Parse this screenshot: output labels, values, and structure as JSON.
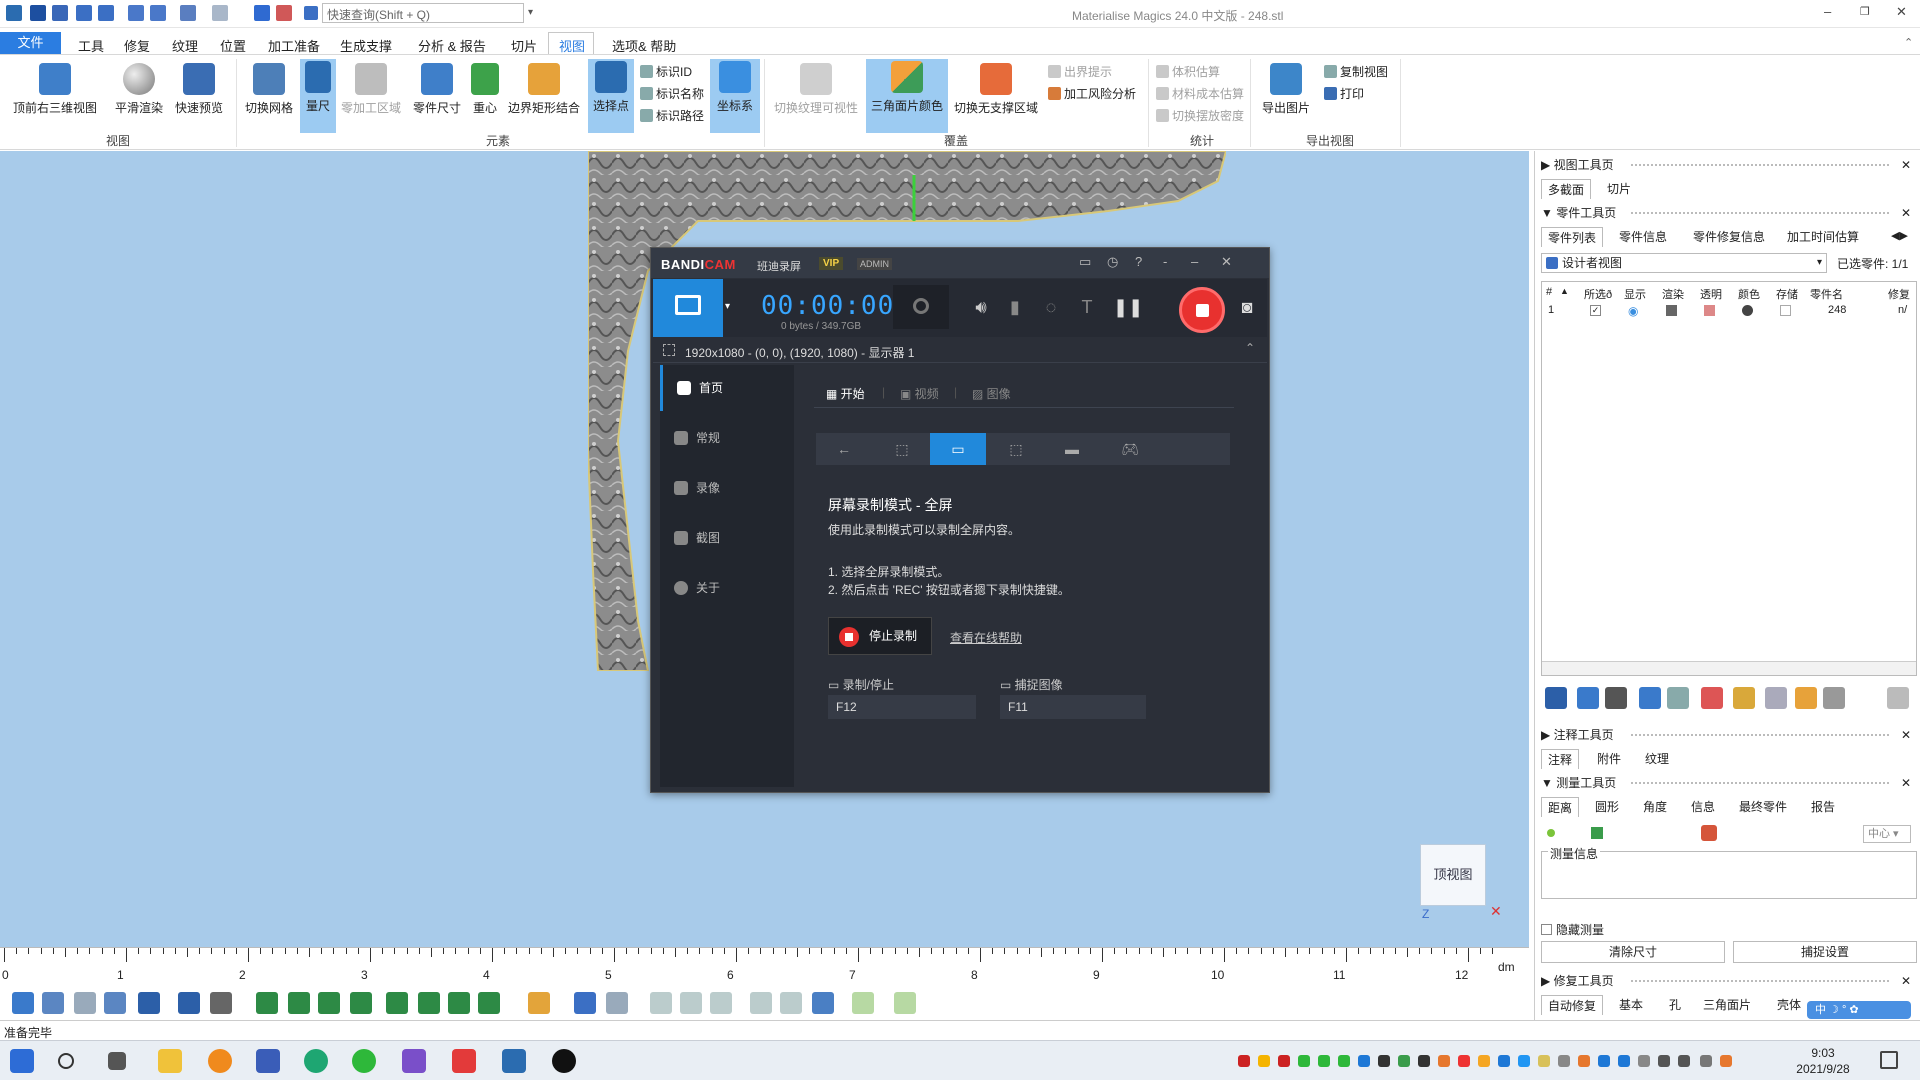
{
  "titlebar": {
    "search_placeholder": "快速查询(Shift + Q)",
    "app_title": "Materialise Magics 24.0 中文版 - 248.stl"
  },
  "menu": [
    "文件",
    "工具",
    "修复",
    "纹理",
    "位置",
    "加工准备",
    "生成支撑",
    "分析 & 报告",
    "切片",
    "视图",
    "选项& 帮助"
  ],
  "ribbon": {
    "buttons": [
      {
        "label": "顶前右三维视图",
        "state": "normal"
      },
      {
        "label": "平滑渲染",
        "state": "normal"
      },
      {
        "label": "快速预览",
        "state": "normal"
      },
      {
        "label": "切换网格",
        "state": "normal"
      },
      {
        "label": "量尺",
        "state": "active"
      },
      {
        "label": "零加工区域",
        "state": "disabled"
      },
      {
        "label": "零件尺寸",
        "state": "normal"
      },
      {
        "label": "重心",
        "state": "normal"
      },
      {
        "label": "边界矩形结合",
        "state": "normal"
      },
      {
        "label": "选择点",
        "state": "active"
      },
      {
        "label": "坐标系",
        "state": "active"
      },
      {
        "label": "切换纹理可视性",
        "state": "disabled"
      },
      {
        "label": "三角面片颜色",
        "state": "active"
      },
      {
        "label": "切换无支撑区域",
        "state": "normal"
      },
      {
        "label": "导出图片",
        "state": "normal"
      }
    ],
    "small": [
      {
        "label": "标识ID",
        "state": "normal"
      },
      {
        "label": "标识名称",
        "state": "normal"
      },
      {
        "label": "标识路径",
        "state": "normal"
      },
      {
        "label": "出界提示",
        "state": "disabled"
      },
      {
        "label": "加工风险分析",
        "state": "normal"
      },
      {
        "label": "体积估算",
        "state": "disabled"
      },
      {
        "label": "材料成本估算",
        "state": "disabled"
      },
      {
        "label": "切换摆放密度",
        "state": "disabled"
      },
      {
        "label": "复制视图",
        "state": "normal"
      },
      {
        "label": "打印",
        "state": "normal"
      }
    ],
    "groups": [
      "视图",
      "元素",
      "覆盖",
      "统计",
      "导出视图"
    ]
  },
  "viewport": {
    "viewcube_label": "顶视图",
    "ruler_numbers": [
      "0",
      "1",
      "2",
      "3",
      "4",
      "5",
      "6",
      "7",
      "8",
      "9",
      "10",
      "11",
      "12"
    ],
    "ruler_unit": "dm"
  },
  "status": {
    "text": "准备完毕"
  },
  "rightpanel": {
    "view_tools": {
      "title": "视图工具页",
      "tabs": [
        "多截面",
        "切片"
      ]
    },
    "part_tools": {
      "title": "零件工具页",
      "tabs": [
        "零件列表",
        "零件信息",
        "零件修复信息",
        "加工时间估算"
      ],
      "view_select": "设计者视图",
      "selected_count": "已选零件: 1/1",
      "columns": [
        "#",
        "所选ð",
        "显示",
        "渲染",
        "透明",
        "颜色",
        "存储",
        "零件名",
        "修复"
      ],
      "rows": [
        {
          "index": "1",
          "name": "248",
          "fix": "n/"
        }
      ]
    },
    "annotation_tools": {
      "title": "注释工具页",
      "tabs": [
        "注释",
        "附件",
        "纹理"
      ]
    },
    "measure_tools": {
      "title": "测量工具页",
      "tabs": [
        "距离",
        "圆形",
        "角度",
        "信息",
        "最终零件",
        "报告"
      ],
      "center_label": "中心",
      "info_label": "测量信息",
      "hide_label": "隐藏测量",
      "clear_btn": "清除尺寸",
      "capture_btn": "捕捉设置"
    },
    "repair_tools": {
      "title": "修复工具页",
      "tabs": [
        "自动修复",
        "基本",
        "孔",
        "三角面片",
        "壳体"
      ]
    }
  },
  "bandicam": {
    "logo_bandi": "BANDI",
    "logo_cam": "CAM",
    "name_cn": "班迪录屏",
    "vip": "VIP",
    "admin": "ADMIN",
    "timer": "00:00:00",
    "bytes": "0 bytes / 349.7GB",
    "area": "1920x1080 - (0, 0), (1920, 1080) - 显示器 1",
    "sidebar": [
      "首页",
      "常规",
      "录像",
      "截图",
      "关于"
    ],
    "tabs": [
      "开始",
      "视频",
      "图像"
    ],
    "mode_title": "屏幕录制模式 - 全屏",
    "mode_desc": "使用此录制模式可以录制全屏内容。",
    "step1": "1. 选择全屏录制模式。",
    "step2": "2. 然后点击 'REC' 按钮或者摁下录制快捷键。",
    "stop_label": "停止录制",
    "help_link": "查看在线帮助",
    "hotkey_record_label": "录制/停止",
    "hotkey_record": "F12",
    "hotkey_capture_label": "捕捉图像",
    "hotkey_capture": "F11"
  },
  "taskbar": {
    "time": "9:03",
    "date": "2021/9/28"
  }
}
